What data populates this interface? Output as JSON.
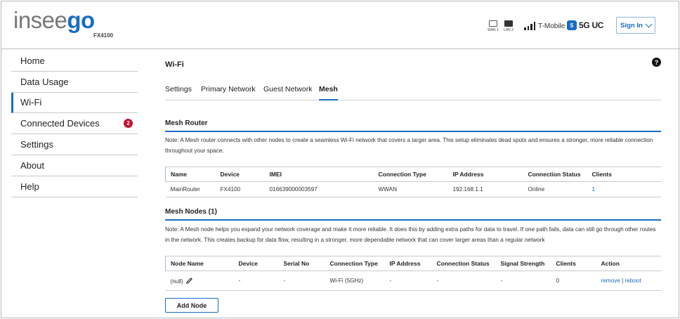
{
  "header": {
    "brand_prefix": "insee",
    "brand_suffix": "go",
    "model": "FX4100",
    "ports": [
      {
        "label": "WAN 1",
        "icon": "ethernet-port-icon",
        "active": false
      },
      {
        "label": "LAN 2",
        "icon": "ethernet-port-icon",
        "active": true
      }
    ],
    "signal_bars": 4,
    "carrier": "T-Mobile",
    "network_type": "5G UC",
    "signin_label": "Sign In"
  },
  "sidebar": {
    "items": [
      {
        "label": "Home"
      },
      {
        "label": "Data Usage"
      },
      {
        "label": "Wi-Fi",
        "active": true
      },
      {
        "label": "Connected Devices",
        "badge": "2"
      },
      {
        "label": "Settings"
      },
      {
        "label": "About"
      },
      {
        "label": "Help"
      }
    ]
  },
  "main": {
    "title": "Wi-Fi",
    "help_glyph": "?",
    "tabs": [
      "Settings",
      "Primary Network",
      "Guest Network",
      "Mesh"
    ],
    "active_tab": "Mesh",
    "mesh_router": {
      "title": "Mesh Router",
      "note": "Note: A Mesh router connects with other nodes to create a seamless Wi-Fi network that covers a larger area. This setup eliminates dead spots and ensures a stronger, more reliable connection throughout your space.",
      "columns": [
        "Name",
        "Device",
        "IMEI",
        "Connection Type",
        "IP Address",
        "Connection Status",
        "Clients"
      ],
      "rows": [
        [
          "MainRouter",
          "FX4100",
          "016639000003597",
          "WWAN",
          "192.168.1.1",
          "Online",
          "1"
        ]
      ]
    },
    "mesh_nodes": {
      "title": "Mesh Nodes (1)",
      "note": "Note: A Mesh node helps you expand your network coverage and make it more reliable. It does this by adding extra paths for data to travel. If one path fails, data can still go through other routes in the network. This creates backup for data flow, resulting in a stronger, more dependable network that can cover larger areas than a regular network",
      "columns": [
        "Node Name",
        "Device",
        "Serial No",
        "Connection Type",
        "IP Address",
        "Connection Status",
        "Signal Strength",
        "Clients",
        "Action"
      ],
      "rows": [
        {
          "node_name": "(null)",
          "device": "-",
          "serial": "-",
          "conn_type": "Wi-Fi (5GHz)",
          "ip": "-",
          "status": "-",
          "signal": "-",
          "clients": "0",
          "remove": "remove",
          "separator": "|",
          "reboot": "reboot"
        }
      ],
      "add_button": "Add Node"
    }
  }
}
